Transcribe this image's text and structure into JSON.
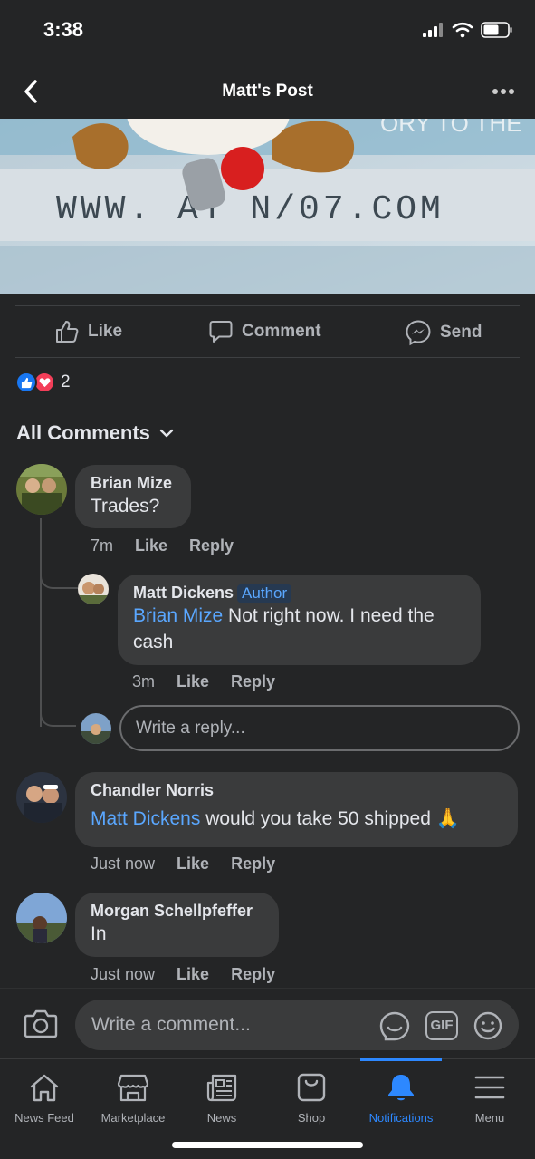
{
  "status": {
    "time": "3:38"
  },
  "nav": {
    "title": "Matt's Post"
  },
  "photo": {
    "text_top": "ORY TO THE",
    "text_url": "WWW.  AT  N/07.COM"
  },
  "actions": {
    "like": "Like",
    "comment": "Comment",
    "send": "Send"
  },
  "reactions": {
    "count": "2"
  },
  "comments_header": {
    "label": "All Comments"
  },
  "comments": [
    {
      "author": "Brian Mize",
      "text": "Trades?",
      "time": "7m",
      "like": "Like",
      "reply": "Reply"
    },
    {
      "author": "Matt Dickens",
      "badge": "Author",
      "mention": "Brian Mize",
      "text": " Not right now. I need the cash",
      "time": "3m",
      "like": "Like",
      "reply": "Reply"
    },
    {
      "author": "Chandler Norris",
      "mention": "Matt Dickens",
      "text": " would you take 50 shipped 🙏",
      "time": "Just now",
      "like": "Like",
      "reply": "Reply"
    },
    {
      "author": "Morgan Schellpfeffer",
      "text": "In",
      "time": "Just now",
      "like": "Like",
      "reply": "Reply"
    }
  ],
  "reply_input": {
    "placeholder": "Write a reply..."
  },
  "composer": {
    "placeholder": "Write a comment...",
    "gif": "GIF"
  },
  "tabs": [
    {
      "label": "News Feed",
      "icon": "home-icon"
    },
    {
      "label": "Marketplace",
      "icon": "marketplace-icon"
    },
    {
      "label": "News",
      "icon": "news-icon"
    },
    {
      "label": "Shop",
      "icon": "shop-icon"
    },
    {
      "label": "Notifications",
      "icon": "bell-icon",
      "active": true
    },
    {
      "label": "Menu",
      "icon": "menu-icon"
    }
  ],
  "colors": {
    "background": "#242526",
    "bubble": "#3a3b3c",
    "accent": "#2d88ff",
    "mention": "#5aa7ff"
  }
}
